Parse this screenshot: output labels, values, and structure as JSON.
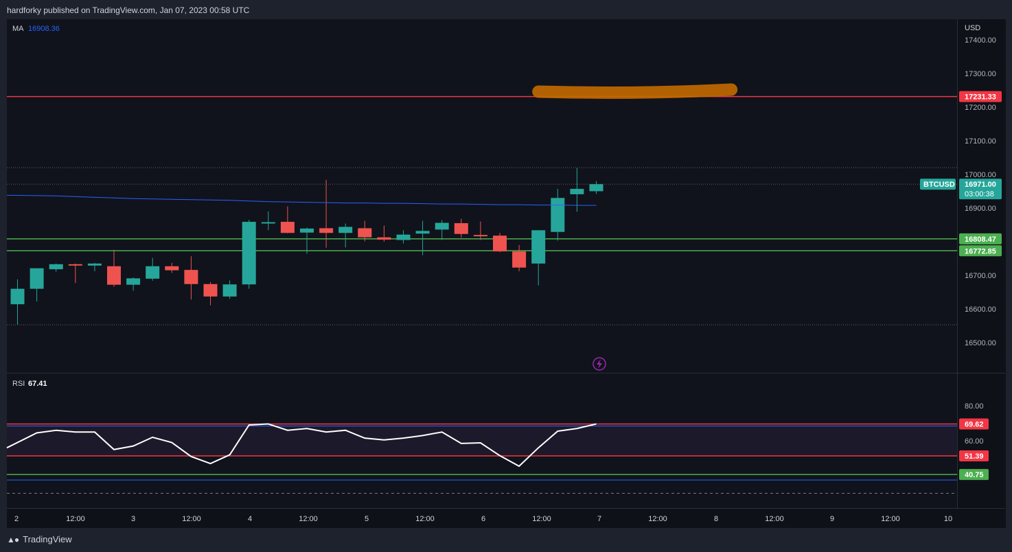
{
  "header": {
    "publish_text": "hardforky published on TradingView.com, Jan 07, 2023 00:58 UTC"
  },
  "footer": {
    "brand": "TradingView"
  },
  "main_pane": {
    "indicator_label": "MA",
    "indicator_value": "16908.36",
    "currency": "USD",
    "symbol": "BTCUSD",
    "last_price": "16971.00",
    "countdown": "03:00:38",
    "y_ticks": [
      "17400.00",
      "17300.00",
      "17200.00",
      "17100.00",
      "17000.00",
      "16900.00",
      "16800.00",
      "16700.00",
      "16600.00",
      "16500.00"
    ],
    "resistance_label": "17231.33",
    "support1_label": "16808.47",
    "support2_label": "16772.85"
  },
  "rsi_pane": {
    "label": "RSI",
    "value": "67.41",
    "y_ticks": [
      "80.00",
      "60.00"
    ],
    "upper_label": "69.62",
    "middle_label": "51.39",
    "lower_label": "40.75"
  },
  "x_ticks": [
    "2",
    "12:00",
    "3",
    "12:00",
    "4",
    "12:00",
    "5",
    "12:00",
    "6",
    "12:00",
    "7",
    "12:00",
    "8",
    "12:00",
    "9",
    "12:00",
    "10"
  ],
  "colors": {
    "up": "#26a69a",
    "down": "#ef5350",
    "ma": "#2962ff",
    "rsi": "#ffffff",
    "highlight": "#c46a00",
    "resistance": "#f23645",
    "support": "#4caf50"
  },
  "chart_data": [
    {
      "type": "candlestick",
      "title": "BTCUSD",
      "ylabel": "USD",
      "ylim": [
        16440,
        17460
      ],
      "candles": [
        {
          "o": 16614,
          "h": 16688,
          "l": 16553,
          "c": 16660
        },
        {
          "o": 16660,
          "h": 16713,
          "l": 16622,
          "c": 16721
        },
        {
          "o": 16718,
          "h": 16735,
          "l": 16711,
          "c": 16733
        },
        {
          "o": 16733,
          "h": 16735,
          "l": 16677,
          "c": 16729
        },
        {
          "o": 16729,
          "h": 16737,
          "l": 16712,
          "c": 16735
        },
        {
          "o": 16727,
          "h": 16776,
          "l": 16666,
          "c": 16672
        },
        {
          "o": 16672,
          "h": 16694,
          "l": 16654,
          "c": 16691
        },
        {
          "o": 16690,
          "h": 16752,
          "l": 16684,
          "c": 16727
        },
        {
          "o": 16727,
          "h": 16737,
          "l": 16707,
          "c": 16715
        },
        {
          "o": 16716,
          "h": 16757,
          "l": 16628,
          "c": 16674
        },
        {
          "o": 16674,
          "h": 16680,
          "l": 16611,
          "c": 16637
        },
        {
          "o": 16637,
          "h": 16685,
          "l": 16630,
          "c": 16673
        },
        {
          "o": 16673,
          "h": 16865,
          "l": 16660,
          "c": 16859
        },
        {
          "o": 16858,
          "h": 16890,
          "l": 16834,
          "c": 16858
        },
        {
          "o": 16859,
          "h": 16905,
          "l": 16825,
          "c": 16826
        },
        {
          "o": 16827,
          "h": 16842,
          "l": 16764,
          "c": 16839
        },
        {
          "o": 16840,
          "h": 16984,
          "l": 16782,
          "c": 16826
        },
        {
          "o": 16826,
          "h": 16854,
          "l": 16783,
          "c": 16844
        },
        {
          "o": 16840,
          "h": 16862,
          "l": 16801,
          "c": 16813
        },
        {
          "o": 16813,
          "h": 16848,
          "l": 16800,
          "c": 16806
        },
        {
          "o": 16805,
          "h": 16834,
          "l": 16795,
          "c": 16821
        },
        {
          "o": 16824,
          "h": 16862,
          "l": 16760,
          "c": 16832
        },
        {
          "o": 16836,
          "h": 16864,
          "l": 16805,
          "c": 16856
        },
        {
          "o": 16855,
          "h": 16868,
          "l": 16812,
          "c": 16823
        },
        {
          "o": 16820,
          "h": 16860,
          "l": 16805,
          "c": 16817
        },
        {
          "o": 16818,
          "h": 16826,
          "l": 16769,
          "c": 16771
        },
        {
          "o": 16771,
          "h": 16790,
          "l": 16712,
          "c": 16723
        },
        {
          "o": 16735,
          "h": 16834,
          "l": 16670,
          "c": 16834
        },
        {
          "o": 16829,
          "h": 16957,
          "l": 16803,
          "c": 16930
        },
        {
          "o": 16941,
          "h": 17019,
          "l": 16889,
          "c": 16957
        },
        {
          "o": 16950,
          "h": 16980,
          "l": 16942,
          "c": 16971
        }
      ],
      "moving_average": [
        16938,
        16937,
        16936,
        16934,
        16932,
        16930,
        16928,
        16927,
        16926,
        16925,
        16924,
        16923,
        16921,
        16919,
        16918,
        16917,
        16916,
        16915,
        16915,
        16914,
        16914,
        16913,
        16912,
        16912,
        16911,
        16910,
        16910,
        16909,
        16909,
        16908,
        16908
      ],
      "horizontal_lines": {
        "resistance": 17231.33,
        "support": [
          16808.47,
          16772.85
        ],
        "dotted": [
          17020,
          16971,
          16553
        ]
      },
      "highlight": {
        "from_candle": 27,
        "to_candle": 37,
        "level": 17250
      }
    },
    {
      "type": "line",
      "title": "RSI",
      "ylim": [
        10,
        100
      ],
      "values": [
        56,
        64.5,
        66,
        65,
        65,
        55,
        57,
        62,
        59,
        51,
        47,
        52,
        69,
        69.6,
        66,
        67,
        65,
        66,
        61.5,
        60.5,
        61.5,
        63,
        65,
        58.5,
        58.8,
        51.5,
        45.5,
        56,
        65.5,
        67,
        69.62
      ],
      "horizontal_lines": {
        "upper": 69.62,
        "middle": 51.39,
        "lower": 40.75,
        "dashed": 30
      }
    }
  ]
}
